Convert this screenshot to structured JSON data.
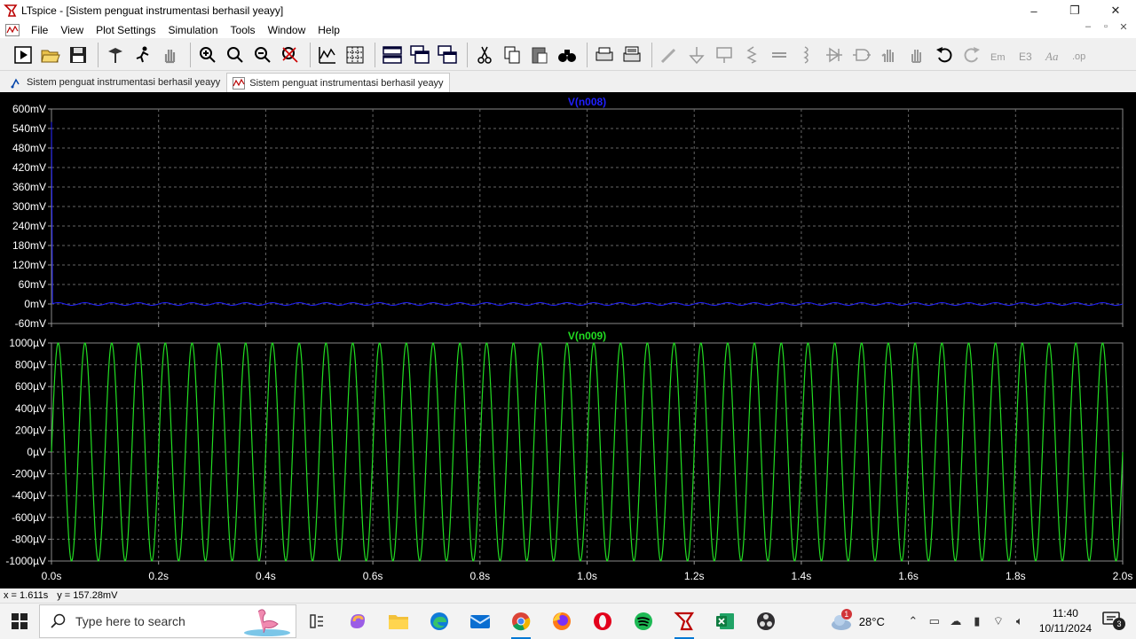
{
  "window": {
    "app_name": "LTspice",
    "title": "LTspice - [Sistem penguat instrumentasi berhasil yeayy]",
    "controls": [
      "–",
      "❐",
      "✕"
    ]
  },
  "menu": [
    "File",
    "View",
    "Plot Settings",
    "Simulation",
    "Tools",
    "Window",
    "Help"
  ],
  "mdi_controls": [
    "–",
    "▫",
    "✕"
  ],
  "toolbar": {
    "icons": [
      "run-icon",
      "open-icon",
      "save-icon",
      "control-panel-icon",
      "halt-icon",
      "pan-icon",
      "zoom-in-icon",
      "zoom-box-icon",
      "zoom-out-icon",
      "zoom-fit-icon",
      "autorange-icon",
      "grid-icon",
      "tile-horizontal-icon",
      "cascade-icon",
      "tile-vertical-icon",
      "cut-icon",
      "copy-icon",
      "paste-icon",
      "find-icon",
      "print-icon",
      "print-setup-icon",
      "wire-icon",
      "ground-icon",
      "label-icon",
      "resistor-icon",
      "capacitor-icon",
      "inductor-icon",
      "diode-icon",
      "component-icon",
      "move-icon",
      "drag-icon",
      "undo-icon",
      "redo-icon",
      "rotate-icon",
      "mirror-icon",
      "text-icon",
      "spice-directive-icon"
    ]
  },
  "tabs": [
    {
      "label": "Sistem penguat instrumentasi berhasil yeayy",
      "icon": "schematic-icon",
      "active": false
    },
    {
      "label": "Sistem penguat instrumentasi berhasil yeayy",
      "icon": "waveform-icon",
      "active": true
    }
  ],
  "colors": {
    "blue_trace": "#2020ff",
    "green_trace": "#22dd22",
    "grid": "#666666",
    "axis_text": "#ffffff"
  },
  "chart_data": [
    {
      "type": "line",
      "title": "V(n008)",
      "ylabel_ticks": [
        "600mV",
        "540mV",
        "480mV",
        "420mV",
        "360mV",
        "300mV",
        "240mV",
        "180mV",
        "120mV",
        "60mV",
        "0mV",
        "-60mV"
      ],
      "ylim": [
        -60,
        600
      ],
      "yunit": "mV",
      "xlim": [
        0,
        2.0
      ],
      "series": [
        {
          "name": "V(n008)",
          "color": "#2020ff",
          "description": "near 0mV with small ripple, initial spike to ~560mV at t=0",
          "amplitude": 4,
          "frequency_hz": 20,
          "offset": 0,
          "initial_spike": 560
        }
      ]
    },
    {
      "type": "line",
      "title": "V(n009)",
      "ylabel_ticks": [
        "1000µV",
        "800µV",
        "600µV",
        "400µV",
        "200µV",
        "0µV",
        "-200µV",
        "-400µV",
        "-600µV",
        "-800µV",
        "-1000µV"
      ],
      "ylim": [
        -1000,
        1000
      ],
      "yunit": "µV",
      "xlim": [
        0,
        2.0
      ],
      "xticks": [
        "0.0s",
        "0.2s",
        "0.4s",
        "0.6s",
        "0.8s",
        "1.0s",
        "1.2s",
        "1.4s",
        "1.6s",
        "1.8s",
        "2.0s"
      ],
      "series": [
        {
          "name": "V(n009)",
          "color": "#22dd22",
          "amplitude": 1000,
          "frequency_hz": 20,
          "offset": 0
        }
      ]
    }
  ],
  "status": {
    "x": "x = 1.611s",
    "y": "y = 157.28mV"
  },
  "taskbar": {
    "search_placeholder": "Type here to search",
    "apps": [
      "task-view-icon",
      "copilot-icon",
      "file-explorer-icon",
      "edge-icon",
      "mail-icon",
      "chrome-icon",
      "firefox-icon",
      "opera-icon",
      "spotify-icon",
      "ltspice-icon",
      "excel-icon",
      "obs-icon"
    ],
    "weather_temp": "28°C",
    "weather_badge": "1",
    "time": "11:40",
    "date": "10/11/2024",
    "notification_count": "3"
  }
}
